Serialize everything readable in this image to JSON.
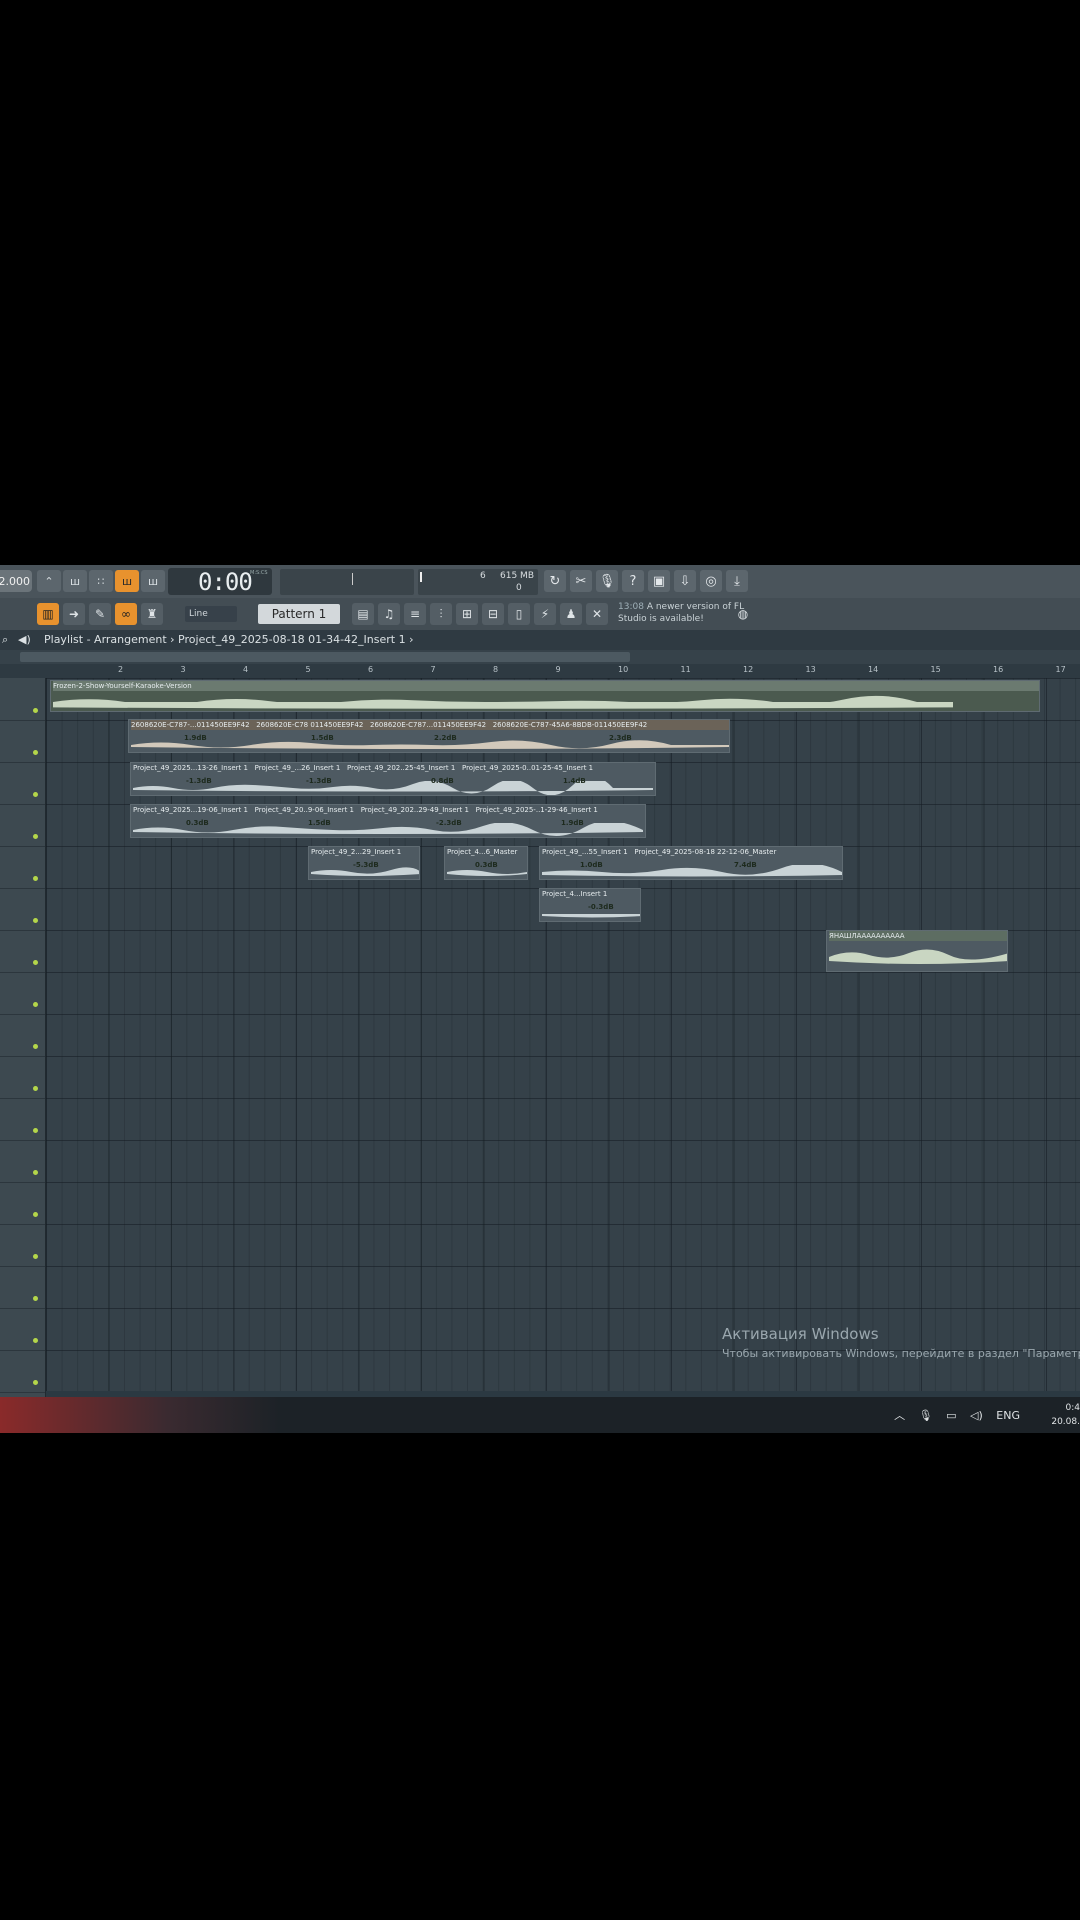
{
  "transport": {
    "tempo": "2.000",
    "time": "0:00",
    "time_small": ":00",
    "time_unit": "M:S:CS",
    "memory": "615 MB",
    "cpu_n1": "6",
    "cpu_n2": "0",
    "buttons": [
      "pattern-song",
      "play",
      "stop",
      "record"
    ]
  },
  "toolbar": {
    "snap_label": "Line",
    "pattern_label": "Pattern 1",
    "news_time": "13:08",
    "news_text": "A newer version of FL Studio is available!"
  },
  "breadcrumb": {
    "text": "Playlist - Arrangement › Project_49_2025-08-18 01-34-42_Insert 1 ›"
  },
  "ruler": [
    "2",
    "3",
    "4",
    "5",
    "6",
    "7",
    "8",
    "9",
    "10",
    "11",
    "12",
    "13",
    "14",
    "15",
    "16",
    "17"
  ],
  "clips": [
    {
      "title": "Frozen-2-Show-Yourself-Karaoke-Version"
    },
    {
      "title": "2608620E-C787-...011450EE9F42"
    },
    {
      "title": "2608620E-C78 011450EE9F42"
    },
    {
      "title": "2608620E-C787...011450EE9F42"
    },
    {
      "title": "2608620E-C787-45A6-8BDB-011450EE9F42"
    },
    {
      "title": "Project_49_2025...13-26_Insert 1"
    },
    {
      "title": "Project_49_...26_Insert 1"
    },
    {
      "title": "Project_49_202..25-45_Insert 1"
    },
    {
      "title": "Project_49_2025-0..01-25-45_Insert 1"
    },
    {
      "title": "Project_49_2025...19-06_Insert 1"
    },
    {
      "title": "Project_49_20..9-06_Insert 1"
    },
    {
      "title": "Project_49_202..29-49_Insert 1"
    },
    {
      "title": "Project_49_2025-..1-29-46_Insert 1"
    },
    {
      "title": "Project_49_2...29_Insert 1"
    },
    {
      "title": "Project_4...6_Master"
    },
    {
      "title": "Project_49_...55_Insert 1"
    },
    {
      "title": "Project_49_2025-08-18 22-12-06_Master"
    },
    {
      "title": "Project_4...Insert 1"
    },
    {
      "title": "ЯНАШЛАААААААААА"
    }
  ],
  "gains": [
    "1.9dB",
    "1.5dB",
    "2.2dB",
    "2.3dB",
    "-1.3dB",
    "-1.3dB",
    "0.8dB",
    "1.4dB",
    "0.3dB",
    "1.5dB",
    "-2.3dB",
    "1.9dB",
    "-5.3dB",
    "0.3dB",
    "1.0dB",
    "7.4dB",
    "-0.3dB"
  ],
  "activation": {
    "heading": "Активация Windows",
    "sub": "Чтобы активировать Windows, перейдите в раздел \"Параметры\""
  },
  "taskbar": {
    "lang": "ENG",
    "time": "0:4",
    "date": "20.08."
  },
  "colors": {
    "accent": "#e8922e",
    "grid": "#354149",
    "wave": "#c9d6c2",
    "track_dot": "#b4d64a"
  }
}
